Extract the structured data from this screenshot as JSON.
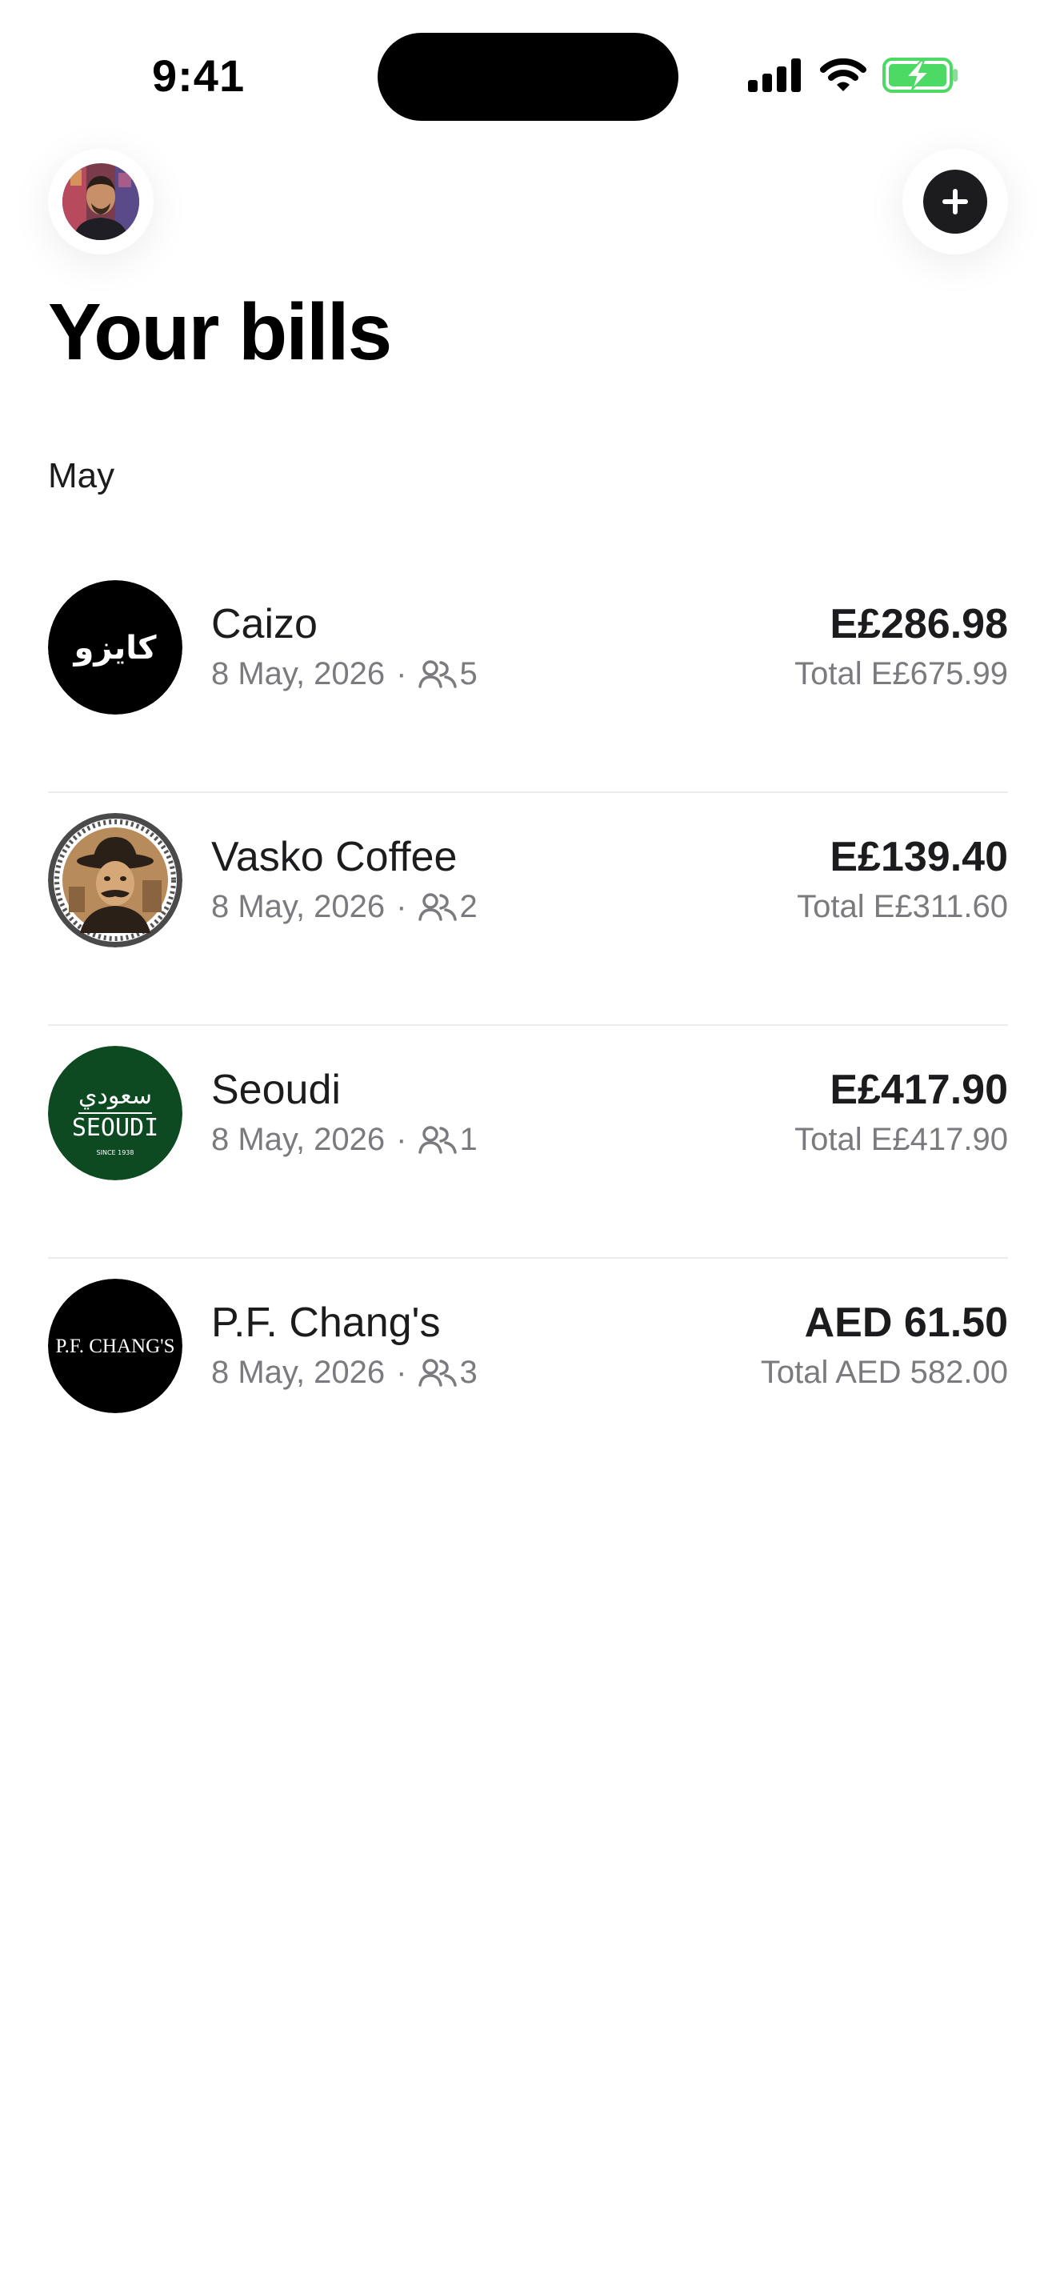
{
  "status_bar": {
    "time": "9:41"
  },
  "header": {
    "title": "Your bills",
    "profile_icon": "user-avatar",
    "add_icon": "plus-icon"
  },
  "section": {
    "month": "May"
  },
  "colors": {
    "battery_charging": "#4cd964",
    "primary_text": "#1c1c1e",
    "secondary_text": "#7a7a7f",
    "seoudi_green": "#0d4a22"
  },
  "bills": [
    {
      "merchant": "Caizo",
      "logo_text": "كايزو",
      "date": "8 May, 2026",
      "separator": "·",
      "people": "5",
      "share": "E£286.98",
      "total": "Total E£675.99"
    },
    {
      "merchant": "Vasko Coffee",
      "logo_text": "",
      "date": "8 May, 2026",
      "separator": "·",
      "people": "2",
      "share": "E£139.40",
      "total": "Total E£311.60"
    },
    {
      "merchant": "Seoudi",
      "logo_text": "سعودي",
      "logo_subtext": "SEOUDI",
      "logo_since": "SINCE 1938",
      "date": "8 May, 2026",
      "separator": "·",
      "people": "1",
      "share": "E£417.90",
      "total": "Total E£417.90"
    },
    {
      "merchant": "P.F. Chang's",
      "logo_text": "P.F. CHANG'S",
      "date": "8 May, 2026",
      "separator": "·",
      "people": "3",
      "share": "AED 61.50",
      "total": "Total AED 582.00"
    }
  ]
}
